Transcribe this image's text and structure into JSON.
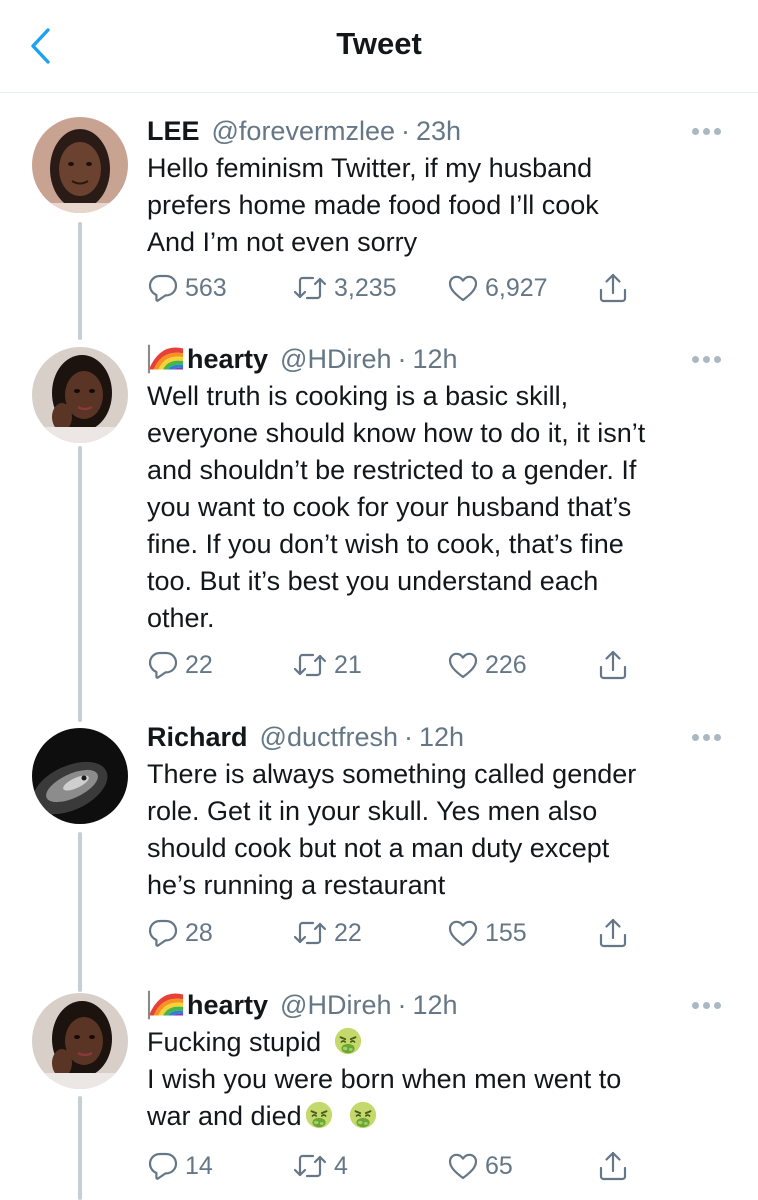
{
  "header": {
    "title": "Tweet"
  },
  "tweets": [
    {
      "name": "LEE",
      "handle": "@forevermzlee",
      "time": "23h",
      "lines": [
        "Hello feminism Twitter, if my husband",
        "prefers home made food food I’ll cook",
        "And I’m not even sorry"
      ],
      "replies": "563",
      "retweets": "3,235",
      "likes": "6,927"
    },
    {
      "name": "hearty",
      "handle": "@HDireh",
      "time": "12h",
      "lines": [
        "Well truth is cooking is a basic skill,",
        "everyone should know how to do it, it isn’t",
        "and shouldn’t be restricted to a gender. If",
        "you want to cook for your husband that’s",
        "fine. If you don’t wish to cook, that’s fine",
        "too. But it’s best you understand each",
        "other."
      ],
      "replies": "22",
      "retweets": "21",
      "likes": "226"
    },
    {
      "name": "Richard",
      "handle": "@ductfresh",
      "time": "12h",
      "lines": [
        "There is always something called gender",
        "role. Get it in your skull.  Yes men also",
        "should cook but not a man duty except",
        "he’s running a restaurant"
      ],
      "replies": "28",
      "retweets": "22",
      "likes": "155"
    },
    {
      "name": "hearty",
      "handle": "@HDireh",
      "time": "12h",
      "lines": [
        "Fucking stupid",
        "I wish you were born when men went to",
        "war and died"
      ],
      "replies": "14",
      "retweets": "4",
      "likes": "65"
    }
  ],
  "icons": {
    "back": "chevron-left-icon",
    "more": "more-horizontal-icon",
    "reply": "reply-icon",
    "retweet": "retweet-icon",
    "like": "heart-icon",
    "share": "share-icon",
    "flag": "rainbow-flag-icon",
    "emoji": "nauseated-face-emoji"
  },
  "colors": {
    "accent": "#1da1f2",
    "muted": "#657786",
    "text": "#14171a"
  }
}
